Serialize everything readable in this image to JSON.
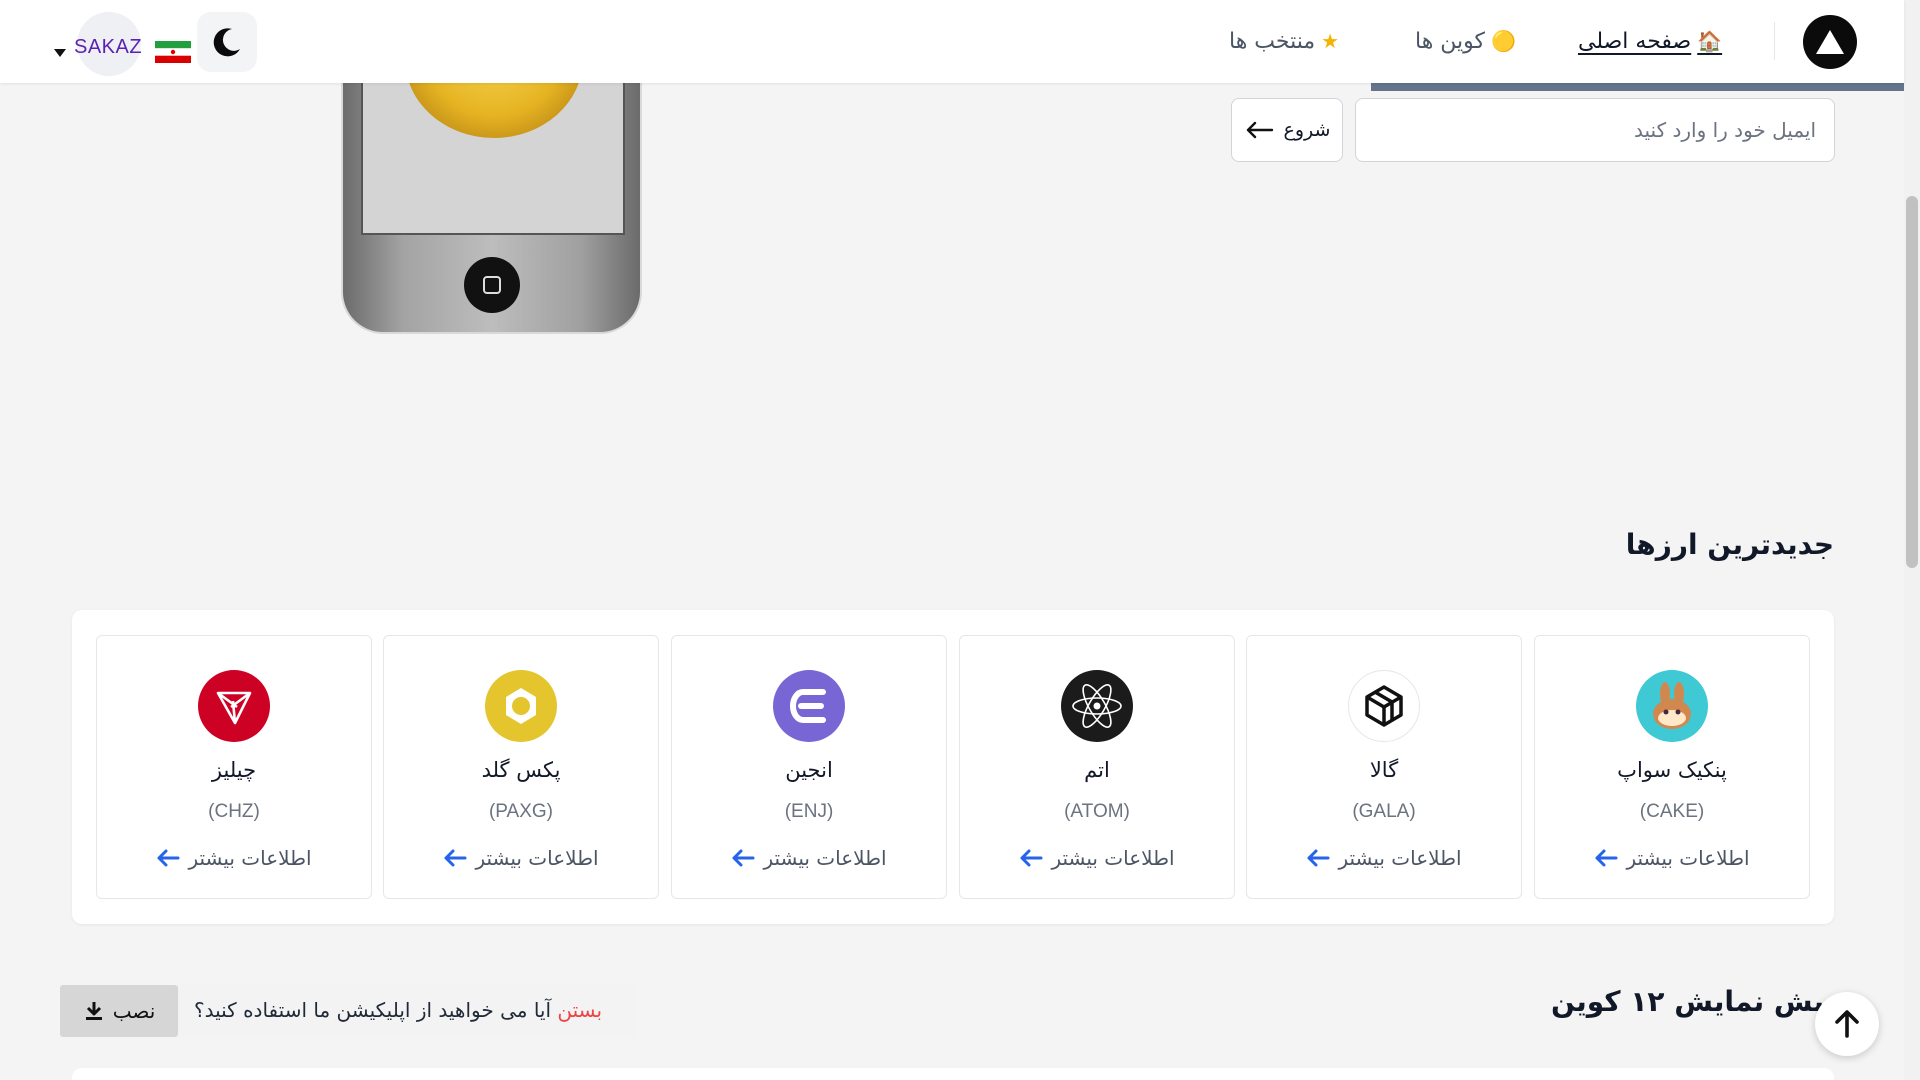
{
  "nav": {
    "home_label": "صفحه اصلی",
    "home_icon": "house-icon",
    "coins_label": "کوین ها",
    "coins_icon": "coin-icon",
    "favorites_label": "منتخب ها",
    "favorites_icon": "star-icon",
    "lang_code": "SAKAZ"
  },
  "hero": {
    "email_placeholder": "ایمیل خود را وارد کنید",
    "start_label": "شروع"
  },
  "newest": {
    "title": "جدیدترین ارزها",
    "more_label": "اطلاعات بیشتر",
    "coins": [
      {
        "name": "پنکیک سواپ",
        "symbol": "(CAKE)",
        "color": "#3fc9d4"
      },
      {
        "name": "گالا",
        "symbol": "(GALA)",
        "color": "#ffffff"
      },
      {
        "name": "اتم",
        "symbol": "(ATOM)",
        "color": "#1b1b1b"
      },
      {
        "name": "انجین",
        "symbol": "(ENJ)",
        "color": "#7866d5"
      },
      {
        "name": "پکس گلد",
        "symbol": "(PAXG)",
        "color": "#e4c52e"
      },
      {
        "name": "چیلیز",
        "symbol": "(CHZ)",
        "color": "#cd0124"
      }
    ]
  },
  "section2": {
    "title": "بش نمایش ۱۲ کوین"
  },
  "install": {
    "close_label": "بستن",
    "question": "آیا می خواهید از اپلیکیشن ما استفاده کنید؟",
    "install_label": "نصب"
  },
  "colors": {
    "accent_link": "#2563eb",
    "close_red": "#ef4444"
  }
}
